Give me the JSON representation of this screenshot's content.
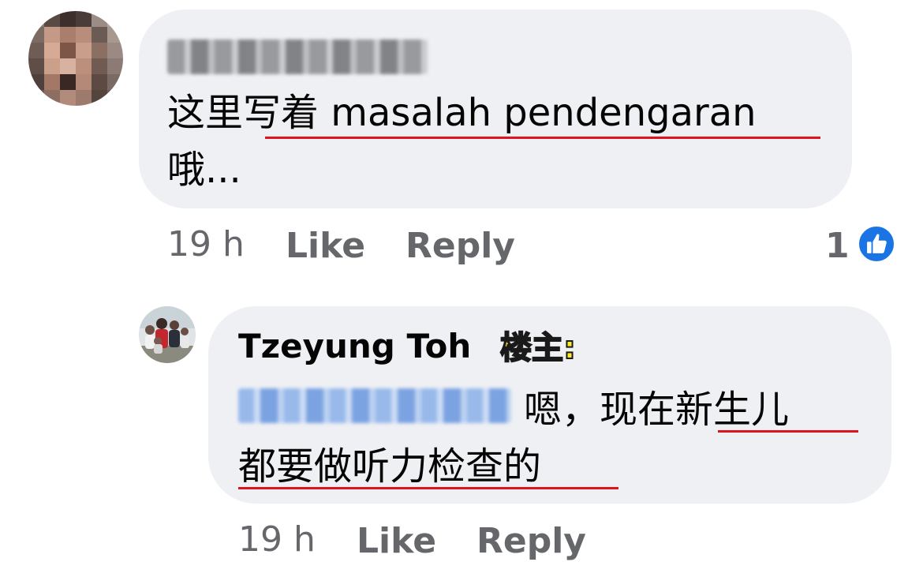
{
  "comments": [
    {
      "time": "19 h",
      "like_label": "Like",
      "reply_label": "Reply",
      "text_line1": "这里写着 masalah pendengaran",
      "text_line2": "哦...",
      "reaction_count": "1",
      "reaction_icon": "thumbs-up-icon"
    },
    {
      "author": "Tzeyung Toh",
      "author_tag": "楼主:",
      "text_line1": "嗯，现在新生儿",
      "text_line2": "都要做听力检查的",
      "time": "19 h",
      "like_label": "Like",
      "reply_label": "Reply"
    }
  ],
  "colors": {
    "bubble_bg": "#eff0f4",
    "meta_text": "#65676b",
    "underline_red": "#e0141e",
    "like_badge_blue": "#1b74e4",
    "tag_yellow": "#ffec1a"
  }
}
